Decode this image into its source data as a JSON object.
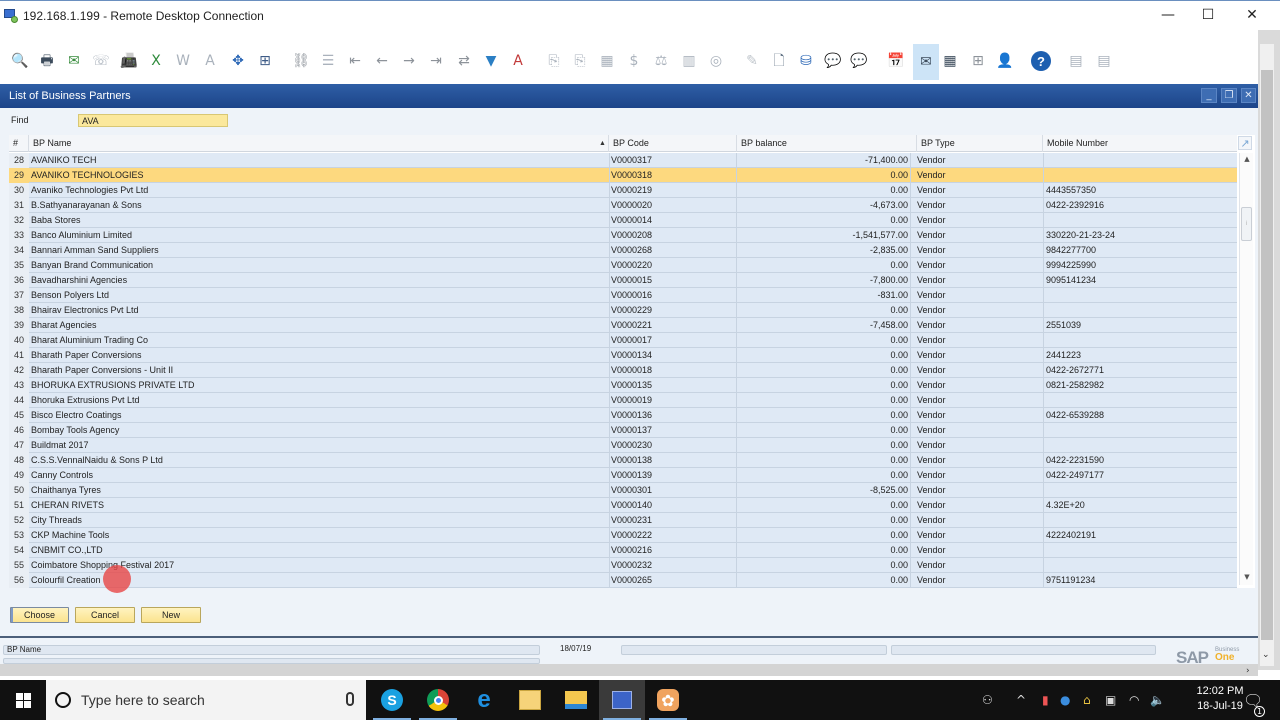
{
  "window": {
    "title": "192.168.1.199 - Remote Desktop Connection",
    "controls": {
      "minimize": "—",
      "maximize": "☐",
      "close": "✕"
    }
  },
  "toolbar": {
    "icons": [
      {
        "name": "print-preview-icon",
        "glyph": "🔍",
        "color": "#5b6d80"
      },
      {
        "name": "print-icon",
        "glyph": "🖶",
        "color": "#3d4c5c"
      },
      {
        "name": "send-email-icon",
        "glyph": "✉",
        "color": "#3a8d3f"
      },
      {
        "name": "sms-icon",
        "glyph": "☏",
        "color": "#aab2bc"
      },
      {
        "name": "fax-icon",
        "glyph": "📠",
        "color": "#5b6d80"
      },
      {
        "name": "export-excel-icon",
        "glyph": "X",
        "color": "#2f8b3c"
      },
      {
        "name": "export-word-icon",
        "glyph": "W",
        "color": "#aab2bc"
      },
      {
        "name": "export-pdf-icon",
        "glyph": "A",
        "color": "#aab2bc"
      },
      {
        "name": "move-icon",
        "glyph": "✥",
        "color": "#2a66b5"
      },
      {
        "name": "lock-screen-icon",
        "glyph": "⊞",
        "color": "#3d5b86"
      },
      {
        "name": "find-icon",
        "glyph": "⛓",
        "color": "#8d939a"
      },
      {
        "name": "add-icon",
        "glyph": "☰",
        "color": "#aab2bc"
      },
      {
        "name": "first-record-icon",
        "glyph": "⇤",
        "color": "#8d939a"
      },
      {
        "name": "previous-record-icon",
        "glyph": "←",
        "color": "#8d939a"
      },
      {
        "name": "next-record-icon",
        "glyph": "→",
        "color": "#8d939a"
      },
      {
        "name": "last-record-icon",
        "glyph": "⇥",
        "color": "#8d939a"
      },
      {
        "name": "refresh-icon",
        "glyph": "⇄",
        "color": "#8d939a"
      },
      {
        "name": "filter-icon",
        "glyph": "▼",
        "color": "#2b7fc4"
      },
      {
        "name": "sort-icon",
        "glyph": "A",
        "color": "#c23a3a"
      },
      {
        "name": "base-document-icon",
        "glyph": "⎘",
        "color": "#aab2bc"
      },
      {
        "name": "target-document-icon",
        "glyph": "⎘",
        "color": "#aab2bc"
      },
      {
        "name": "gross-profit-icon",
        "glyph": "▦",
        "color": "#aab2bc"
      },
      {
        "name": "payment-means-icon",
        "glyph": "$",
        "color": "#aab2bc"
      },
      {
        "name": "volume-weight-icon",
        "glyph": "⚖",
        "color": "#aab2bc"
      },
      {
        "name": "journal-entry-icon",
        "glyph": "▥",
        "color": "#aab2bc"
      },
      {
        "name": "transaction-journal-icon",
        "glyph": "◎",
        "color": "#aab2bc"
      },
      {
        "name": "edit-icon",
        "glyph": "✎",
        "color": "#c0c6cc"
      },
      {
        "name": "new-document-icon",
        "glyph": "🗋",
        "color": "#5b6d80"
      },
      {
        "name": "data-settings-icon",
        "glyph": "⛁",
        "color": "#2a66b5"
      },
      {
        "name": "messages-icon",
        "glyph": "💬",
        "color": "#8d939a"
      },
      {
        "name": "new-message-icon",
        "glyph": "💬",
        "color": "#aab2bc"
      },
      {
        "name": "alerts-icon",
        "glyph": "📅",
        "color": "#2f8b3c"
      },
      {
        "name": "mail-alert-icon",
        "glyph": "✉",
        "color": "#3d4c5c"
      },
      {
        "name": "calendar-icon",
        "glyph": "▦",
        "color": "#3d4c5c"
      },
      {
        "name": "org-structure-icon",
        "glyph": "⊞",
        "color": "#8d939a"
      },
      {
        "name": "user-icon",
        "glyph": "👤",
        "color": "#3d4c5c"
      },
      {
        "name": "help-icon",
        "glyph": "?",
        "color": "#ffffff"
      },
      {
        "name": "report-icon",
        "glyph": "▤",
        "color": "#aab2bc"
      },
      {
        "name": "report-settings-icon",
        "glyph": "▤",
        "color": "#aab2bc"
      }
    ]
  },
  "form": {
    "title": "List of Business Partners",
    "find_label": "Find",
    "find_value": "AVA",
    "columns": {
      "num": "#",
      "name": "BP Name",
      "code": "BP Code",
      "balance": "BP balance",
      "type": "BP Type",
      "mobile": "Mobile Number"
    },
    "rows": [
      {
        "num": "28",
        "name": "AVANIKO TECH",
        "code": "V0000317",
        "balance": "-71,400.00",
        "type": "Vendor",
        "mobile": ""
      },
      {
        "num": "29",
        "name": "AVANIKO TECHNOLOGIES",
        "code": "V0000318",
        "balance": "0.00",
        "type": "Vendor",
        "mobile": "",
        "selected": true
      },
      {
        "num": "30",
        "name": "Avaniko Technologies Pvt Ltd",
        "code": "V0000219",
        "balance": "0.00",
        "type": "Vendor",
        "mobile": "4443557350"
      },
      {
        "num": "31",
        "name": "B.Sathyanarayanan & Sons",
        "code": "V0000020",
        "balance": "-4,673.00",
        "type": "Vendor",
        "mobile": "0422-2392916"
      },
      {
        "num": "32",
        "name": "Baba Stores",
        "code": "V0000014",
        "balance": "0.00",
        "type": "Vendor",
        "mobile": ""
      },
      {
        "num": "33",
        "name": "Banco Aluminium Limited",
        "code": "V0000208",
        "balance": "-1,541,577.00",
        "type": "Vendor",
        "mobile": "330220-21-23-24"
      },
      {
        "num": "34",
        "name": "Bannari Amman Sand Suppliers",
        "code": "V0000268",
        "balance": "-2,835.00",
        "type": "Vendor",
        "mobile": "9842277700"
      },
      {
        "num": "35",
        "name": "Banyan Brand Communication",
        "code": "V0000220",
        "balance": "0.00",
        "type": "Vendor",
        "mobile": "9994225990"
      },
      {
        "num": "36",
        "name": "Bavadharshini Agencies",
        "code": "V0000015",
        "balance": "-7,800.00",
        "type": "Vendor",
        "mobile": "9095141234"
      },
      {
        "num": "37",
        "name": "Benson Polyers Ltd",
        "code": "V0000016",
        "balance": "-831.00",
        "type": "Vendor",
        "mobile": ""
      },
      {
        "num": "38",
        "name": "Bhairav Electronics Pvt Ltd",
        "code": "V0000229",
        "balance": "0.00",
        "type": "Vendor",
        "mobile": ""
      },
      {
        "num": "39",
        "name": "Bharat Agencies",
        "code": "V0000221",
        "balance": "-7,458.00",
        "type": "Vendor",
        "mobile": "2551039"
      },
      {
        "num": "40",
        "name": "Bharat Aluminium Trading Co",
        "code": "V0000017",
        "balance": "0.00",
        "type": "Vendor",
        "mobile": ""
      },
      {
        "num": "41",
        "name": "Bharath Paper Conversions",
        "code": "V0000134",
        "balance": "0.00",
        "type": "Vendor",
        "mobile": "2441223"
      },
      {
        "num": "42",
        "name": "Bharath Paper Conversions - Unit II",
        "code": "V0000018",
        "balance": "0.00",
        "type": "Vendor",
        "mobile": "0422-2672771"
      },
      {
        "num": "43",
        "name": "BHORUKA EXTRUSIONS PRIVATE LTD",
        "code": "V0000135",
        "balance": "0.00",
        "type": "Vendor",
        "mobile": "0821-2582982"
      },
      {
        "num": "44",
        "name": "Bhoruka Extrusions Pvt Ltd",
        "code": "V0000019",
        "balance": "0.00",
        "type": "Vendor",
        "mobile": ""
      },
      {
        "num": "45",
        "name": "Bisco Electro Coatings",
        "code": "V0000136",
        "balance": "0.00",
        "type": "Vendor",
        "mobile": "0422-6539288"
      },
      {
        "num": "46",
        "name": "Bombay Tools Agency",
        "code": "V0000137",
        "balance": "0.00",
        "type": "Vendor",
        "mobile": ""
      },
      {
        "num": "47",
        "name": "Buildmat 2017",
        "code": "V0000230",
        "balance": "0.00",
        "type": "Vendor",
        "mobile": ""
      },
      {
        "num": "48",
        "name": "C.S.S.VennalNaidu & Sons P Ltd",
        "code": "V0000138",
        "balance": "0.00",
        "type": "Vendor",
        "mobile": "0422-2231590"
      },
      {
        "num": "49",
        "name": "Canny Controls",
        "code": "V0000139",
        "balance": "0.00",
        "type": "Vendor",
        "mobile": "0422-2497177"
      },
      {
        "num": "50",
        "name": "Chaithanya Tyres",
        "code": "V0000301",
        "balance": "-8,525.00",
        "type": "Vendor",
        "mobile": ""
      },
      {
        "num": "51",
        "name": "CHERAN RIVETS",
        "code": "V0000140",
        "balance": "0.00",
        "type": "Vendor",
        "mobile": "4.32E+20"
      },
      {
        "num": "52",
        "name": "City Threads",
        "code": "V0000231",
        "balance": "0.00",
        "type": "Vendor",
        "mobile": ""
      },
      {
        "num": "53",
        "name": "CKP Machine Tools",
        "code": "V0000222",
        "balance": "0.00",
        "type": "Vendor",
        "mobile": "4222402191"
      },
      {
        "num": "54",
        "name": "CNBMIT CO.,LTD",
        "code": "V0000216",
        "balance": "0.00",
        "type": "Vendor",
        "mobile": ""
      },
      {
        "num": "55",
        "name": "Coimbatore Shopping Festival 2017",
        "code": "V0000232",
        "balance": "0.00",
        "type": "Vendor",
        "mobile": ""
      },
      {
        "num": "56",
        "name": "Colourfil Creation",
        "code": "V0000265",
        "balance": "0.00",
        "type": "Vendor",
        "mobile": "9751191234"
      }
    ],
    "buttons": {
      "choose": "Choose",
      "cancel": "Cancel",
      "new": "New"
    }
  },
  "statusbar": {
    "field_label": "BP Name",
    "date": "18/07/19",
    "brand_main": "SAP",
    "brand_sub_top": "Business",
    "brand_sub_bottom": "One"
  },
  "taskbar": {
    "search_placeholder": "Type here to search",
    "apps": [
      "skype",
      "chrome",
      "edge",
      "outlook",
      "file-explorer",
      "remote-desktop",
      "sap-business-one"
    ],
    "time": "12:02 PM",
    "date": "18-Jul-19",
    "notification_count": "1"
  },
  "colors": {
    "form_header": "#1c4489",
    "selected_row": "#fdd97f",
    "row_bg": "#dfe9f5",
    "find_bg": "#fbe89c"
  }
}
